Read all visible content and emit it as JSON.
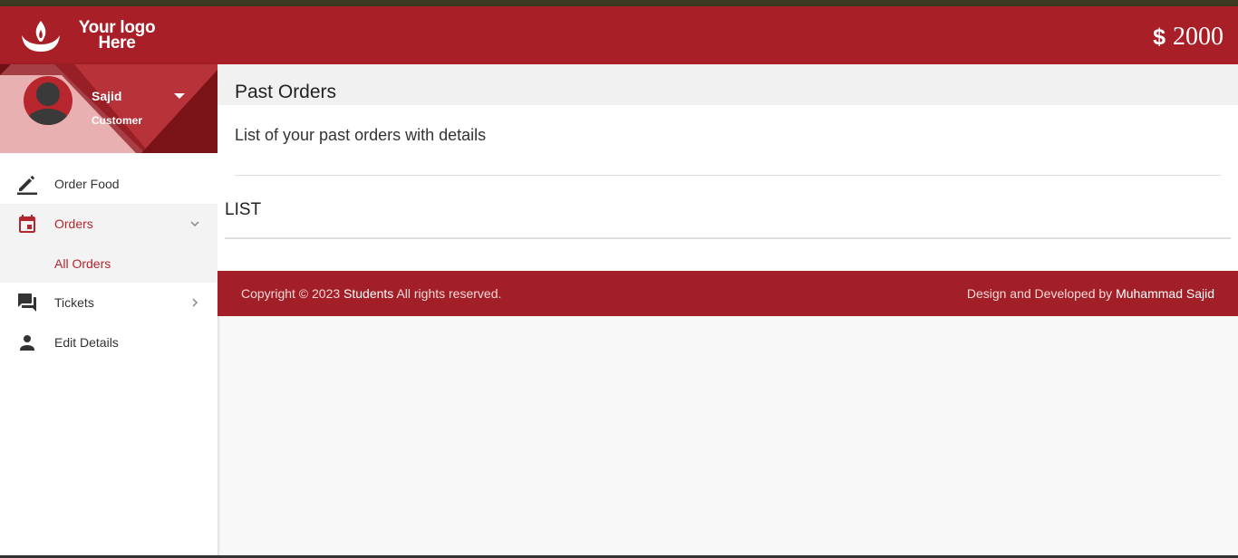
{
  "header": {
    "logo_line1": "Your logo",
    "logo_line2": "Here",
    "currency_symbol": "$",
    "balance": "2000",
    "brand_color": "#a81f27"
  },
  "sidebar": {
    "user_name": "Sajid",
    "user_role": "Customer",
    "items": [
      {
        "label": "Order Food",
        "icon": "pencil-icon"
      },
      {
        "label": "Orders",
        "icon": "calendar-icon"
      },
      {
        "label": "All Orders"
      },
      {
        "label": "Tickets",
        "icon": "chat-icon"
      },
      {
        "label": "Edit Details",
        "icon": "person-icon"
      }
    ]
  },
  "main": {
    "title": "Past Orders",
    "subtitle": "List of your past orders with details",
    "list_heading": "LIST"
  },
  "footer": {
    "copyright_prefix": "Copyright © 2023",
    "org": "Students",
    "rights": "All rights reserved.",
    "credit_prefix": "Design and Developed by",
    "developer": "Muhammad Sajid"
  }
}
